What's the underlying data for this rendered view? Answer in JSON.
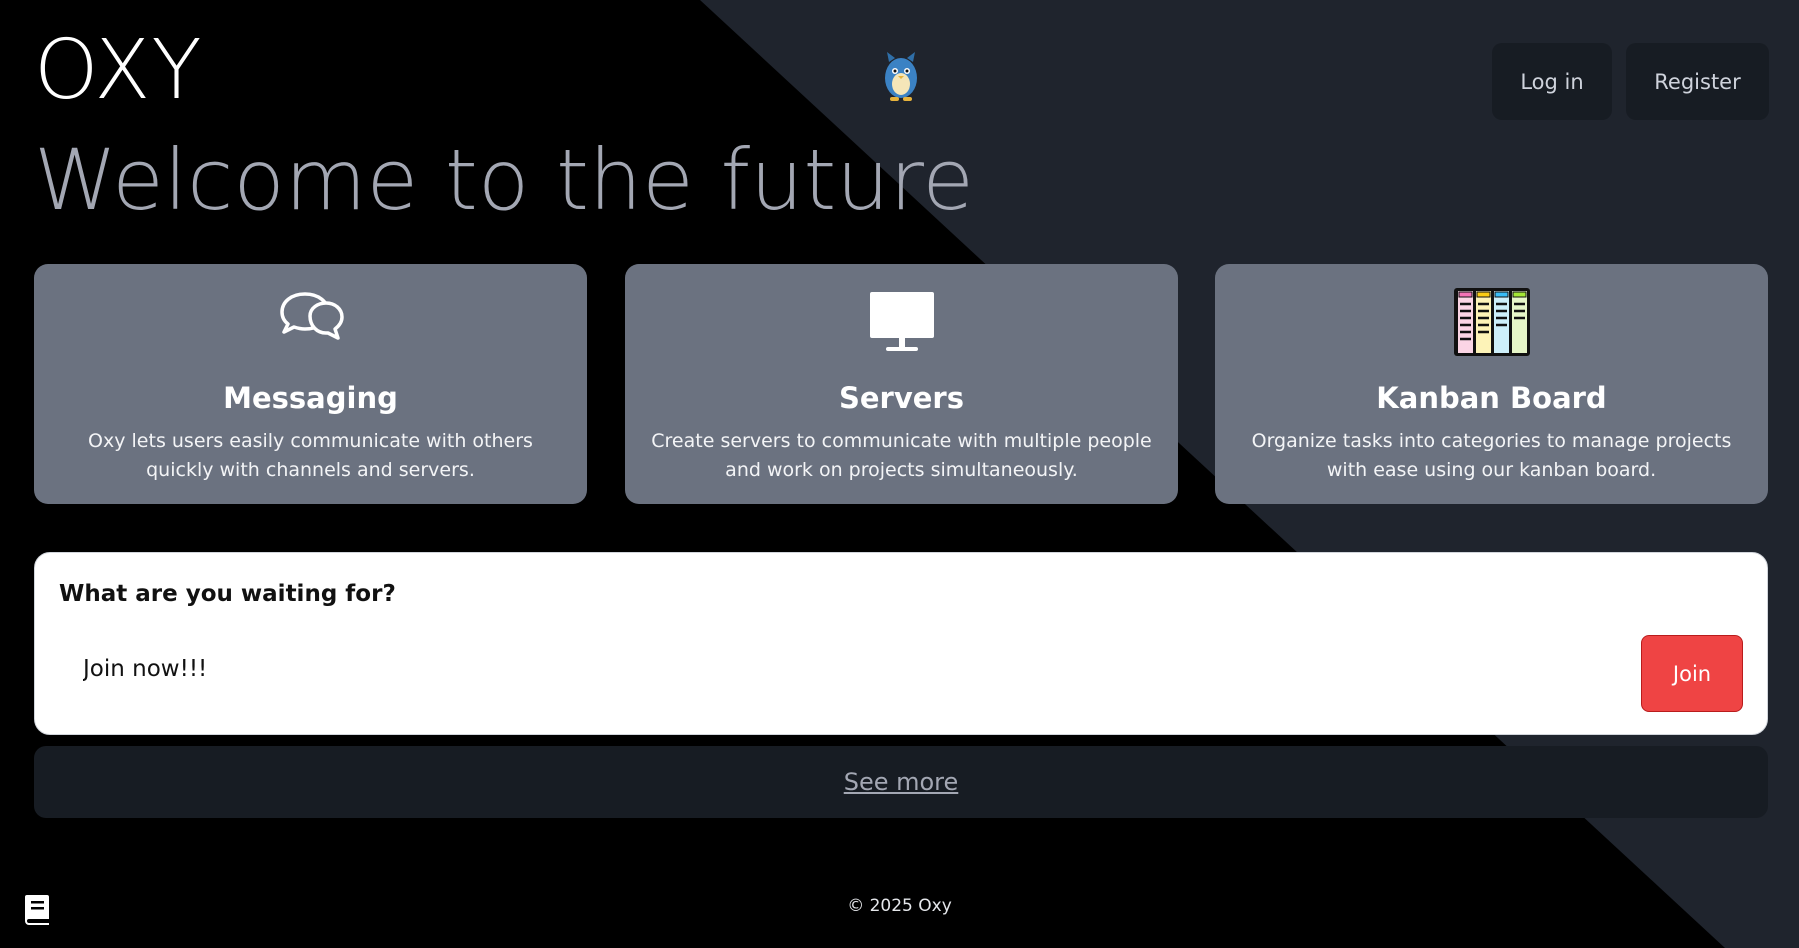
{
  "brand": "OXY",
  "hero": {
    "title": "Welcome to the future"
  },
  "header": {
    "login_label": "Log in",
    "register_label": "Register",
    "mascot_icon": "penguin-mascot-icon"
  },
  "features": [
    {
      "icon": "chat-bubbles-icon",
      "title": "Messaging",
      "description": "Oxy lets users easily communicate with others quickly with channels and servers."
    },
    {
      "icon": "monitor-icon",
      "title": "Servers",
      "description": "Create servers to communicate with multiple people and work on projects simultaneously."
    },
    {
      "icon": "kanban-board-icon",
      "title": "Kanban Board",
      "description": "Organize tasks into categories to manage projects with ease using our kanban board."
    }
  ],
  "cta": {
    "title": "What are you waiting for?",
    "input_value": "Join now!!!",
    "button_label": "Join"
  },
  "see_more": "See more",
  "footer": {
    "copyright": "© 2025 Oxy",
    "icon": "book-icon"
  },
  "colors": {
    "card_bg": "#6b7280",
    "accent": "#ef4444",
    "dark_panel": "#171c23",
    "diagonal": "#1f242d"
  }
}
